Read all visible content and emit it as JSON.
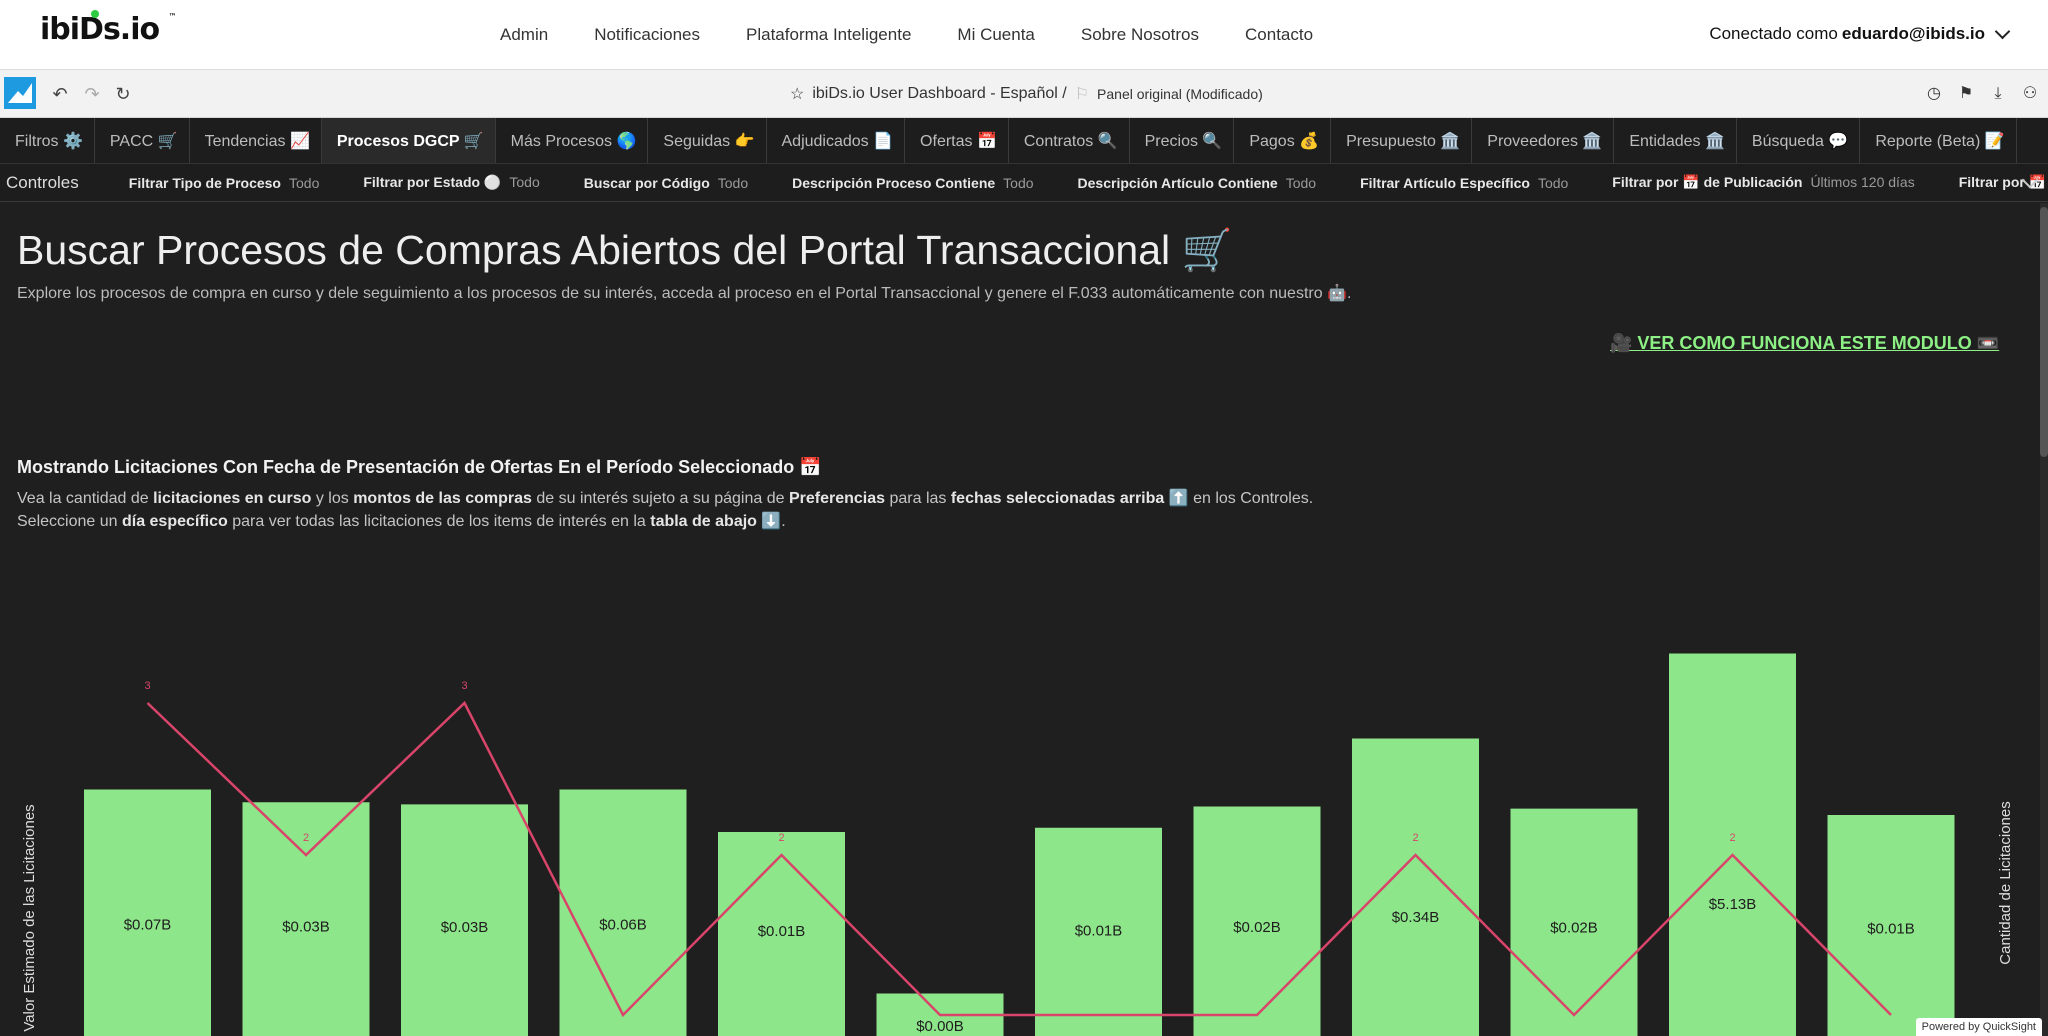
{
  "site": {
    "logo": "ibiDs.io",
    "nav": [
      "Admin",
      "Notificaciones",
      "Plataforma Inteligente",
      "Mi Cuenta",
      "Sobre Nosotros",
      "Contacto"
    ],
    "user_prefix": "Conectado como",
    "user_email": "eduardo@ibids.io"
  },
  "toolbar": {
    "dashboard_title": "ibiDs.io User Dashboard - Español /",
    "sheet_name": "Panel original (Modificado)"
  },
  "tabs": [
    {
      "label": "Filtros ⚙️",
      "active": false
    },
    {
      "label": "PACC 🛒",
      "active": false
    },
    {
      "label": "Tendencias 📈",
      "active": false
    },
    {
      "label": "Procesos DGCP 🛒",
      "active": true
    },
    {
      "label": "Más Procesos 🌎",
      "active": false
    },
    {
      "label": "Seguidas 👉",
      "active": false
    },
    {
      "label": "Adjudicados 📄",
      "active": false
    },
    {
      "label": "Ofertas 📅",
      "active": false
    },
    {
      "label": "Contratos 🔍",
      "active": false
    },
    {
      "label": "Precios 🔍",
      "active": false
    },
    {
      "label": "Pagos 💰",
      "active": false
    },
    {
      "label": "Presupuesto 🏛️",
      "active": false
    },
    {
      "label": "Proveedores 🏛️",
      "active": false
    },
    {
      "label": "Entidades 🏛️",
      "active": false
    },
    {
      "label": "Búsqueda 💬",
      "active": false
    },
    {
      "label": "Reporte (Beta) 📝",
      "active": false
    }
  ],
  "controls": {
    "label": "Controles",
    "items": [
      {
        "name": "Filtrar Tipo de Proceso",
        "value": "Todo"
      },
      {
        "name": "Filtrar por Estado ⚪",
        "value": "Todo"
      },
      {
        "name": "Buscar por Código",
        "value": "Todo"
      },
      {
        "name": "Descripción Proceso Contiene",
        "value": "Todo"
      },
      {
        "name": "Descripción Artículo Contiene",
        "value": "Todo"
      },
      {
        "name": "Filtrar Artículo Específico",
        "value": "Todo"
      },
      {
        "name": "Filtrar por 📅 de Publicación",
        "value": "Últimos 120 días"
      },
      {
        "name": "Filtrar por 📅 Entrega d",
        "value": ""
      }
    ]
  },
  "main": {
    "title": "Buscar Procesos de Compras Abiertos del Portal Transaccional 🛒",
    "lead": "Explore los procesos de compra en curso y dele seguimiento a los procesos de su interés, acceda al proceso en el Portal Transaccional y genere el F.033 automáticamente con nuestro 🤖.",
    "howto": "🎥 VER COMO FUNCIONA ESTE MODULO 📼",
    "subheading": "Mostrando Licitaciones Con Fecha de Presentación de Ofertas En el Período Seleccionado 📅",
    "desc1": {
      "a": "Vea la cantidad de ",
      "b": "licitaciones en curso",
      "c": " y los ",
      "d": "montos de las compras",
      "e": " de su interés sujeto a su página de ",
      "f": "Preferencias",
      "g": " para las ",
      "h": "fechas seleccionadas arriba",
      "i": " ⬆️ en los Controles."
    },
    "desc2": {
      "a": "Seleccione un ",
      "b": "día específico",
      "c": " para ver todas las licitaciones de los items de interés en la ",
      "d": "tabla de abajo",
      "e": " ⬇️."
    }
  },
  "chart_data": {
    "type": "bar",
    "y_left_label": "Valor Estimado de las Licitaciones",
    "y_right_label": "Cantidad de Licitaciones",
    "bar_labels": [
      "$0.07B",
      "$0.03B",
      "$0.03B",
      "$0.06B",
      "$0.01B",
      "$0.00B",
      "$0.01B",
      "$0.02B",
      "$0.34B",
      "$0.02B",
      "$5.13B",
      "$0.01B"
    ],
    "bar_heights_relative": [
      0.58,
      0.55,
      0.545,
      0.58,
      0.48,
      0.1,
      0.49,
      0.54,
      0.7,
      0.535,
      0.9,
      0.52
    ],
    "series": [
      {
        "name": "Valor Estimado de las Licitaciones",
        "color": "#8de68a"
      },
      {
        "name": "Cantidad de Licitaciones",
        "color": "#d9456a",
        "values": [
          3,
          2,
          3,
          1,
          2,
          1,
          1,
          1,
          2,
          1,
          2,
          1
        ],
        "labels": [
          "3",
          "2",
          "3",
          "",
          "2",
          "",
          "",
          "",
          "2",
          "",
          "2",
          ""
        ]
      }
    ]
  },
  "footer": {
    "powered": "Powered by QuickSight"
  }
}
